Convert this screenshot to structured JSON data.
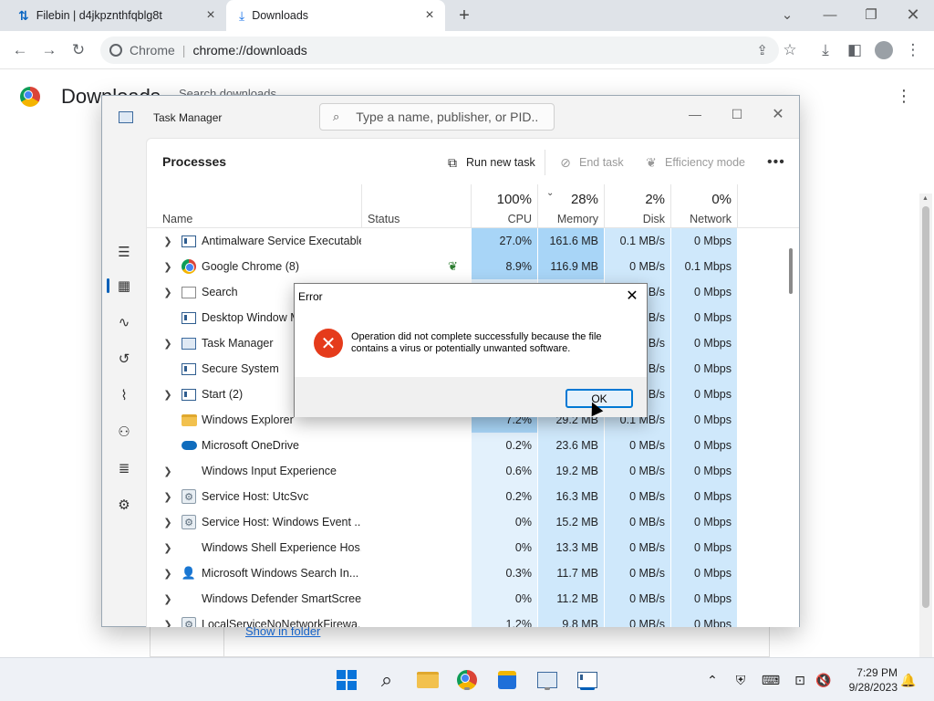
{
  "browser": {
    "tabs": [
      {
        "label": "Filebin | d4jkpznthfqblg8t",
        "active": false
      },
      {
        "label": "Downloads",
        "active": true
      }
    ],
    "omnibox_scheme": "Chrome",
    "omnibox_url": "chrome://downloads"
  },
  "downloads_page": {
    "title": "Downloads",
    "search_placeholder": "Search downloads",
    "show_in_folder": "Show in folder"
  },
  "task_manager": {
    "window_title": "Task Manager",
    "search_placeholder": "Type a name, publisher, or PID...",
    "page_title": "Processes",
    "commands": {
      "run_new_task": "Run new task",
      "end_task": "End task",
      "efficiency_mode": "Efficiency mode"
    },
    "columns": {
      "name": "Name",
      "status": "Status",
      "cpu_pct": "100%",
      "cpu": "CPU",
      "memory_pct": "28%",
      "memory": "Memory",
      "disk_pct": "2%",
      "disk": "Disk",
      "network_pct": "0%",
      "network": "Network"
    },
    "processes": [
      {
        "name": "Antimalware Service Executable",
        "expandable": true,
        "icon": "window-icon",
        "cpu": "27.0%",
        "memory": "161.6 MB",
        "disk": "0.1 MB/s",
        "network": "0 Mbps",
        "leaf": false
      },
      {
        "name": "Google Chrome (8)",
        "expandable": true,
        "icon": "chrome-icon",
        "cpu": "8.9%",
        "memory": "116.9 MB",
        "disk": "0 MB/s",
        "network": "0.1 Mbps",
        "leaf": true
      },
      {
        "name": "Search",
        "expandable": true,
        "icon": "envelope-icon",
        "cpu": "",
        "memory": "",
        "disk": "MB/s",
        "network": "0 Mbps",
        "leaf": false
      },
      {
        "name": "Desktop Window M",
        "expandable": false,
        "icon": "window-icon",
        "cpu": "",
        "memory": "",
        "disk": "MB/s",
        "network": "0 Mbps",
        "leaf": false
      },
      {
        "name": "Task Manager",
        "expandable": true,
        "icon": "task-manager-icon",
        "cpu": "",
        "memory": "",
        "disk": "MB/s",
        "network": "0 Mbps",
        "leaf": false
      },
      {
        "name": "Secure System",
        "expandable": false,
        "icon": "window-icon",
        "cpu": "",
        "memory": "",
        "disk": "MB/s",
        "network": "0 Mbps",
        "leaf": false
      },
      {
        "name": "Start (2)",
        "expandable": true,
        "icon": "window-icon",
        "cpu": "",
        "memory": "",
        "disk": "MB/s",
        "network": "0 Mbps",
        "leaf": false
      },
      {
        "name": "Windows Explorer",
        "expandable": false,
        "icon": "folder-icon",
        "cpu": "7.2%",
        "memory": "29.2 MB",
        "disk": "0.1 MB/s",
        "network": "0 Mbps",
        "leaf": false
      },
      {
        "name": "Microsoft OneDrive",
        "expandable": false,
        "icon": "cloud-icon",
        "cpu": "0.2%",
        "memory": "23.6 MB",
        "disk": "0 MB/s",
        "network": "0 Mbps",
        "leaf": false
      },
      {
        "name": "Windows Input Experience",
        "expandable": true,
        "icon": "",
        "cpu": "0.6%",
        "memory": "19.2 MB",
        "disk": "0 MB/s",
        "network": "0 Mbps",
        "leaf": false
      },
      {
        "name": "Service Host: UtcSvc",
        "expandable": true,
        "icon": "gear-icon",
        "cpu": "0.2%",
        "memory": "16.3 MB",
        "disk": "0 MB/s",
        "network": "0 Mbps",
        "leaf": false
      },
      {
        "name": "Service Host: Windows Event ...",
        "expandable": true,
        "icon": "gear-icon",
        "cpu": "0%",
        "memory": "15.2 MB",
        "disk": "0 MB/s",
        "network": "0 Mbps",
        "leaf": false
      },
      {
        "name": "Windows Shell Experience Hos...",
        "expandable": true,
        "icon": "",
        "cpu": "0%",
        "memory": "13.3 MB",
        "disk": "0 MB/s",
        "network": "0 Mbps",
        "leaf": false
      },
      {
        "name": "Microsoft Windows Search In...",
        "expandable": true,
        "icon": "user-icon",
        "cpu": "0.3%",
        "memory": "11.7 MB",
        "disk": "0 MB/s",
        "network": "0 Mbps",
        "leaf": false
      },
      {
        "name": "Windows Defender SmartScreen",
        "expandable": true,
        "icon": "",
        "cpu": "0%",
        "memory": "11.2 MB",
        "disk": "0 MB/s",
        "network": "0 Mbps",
        "leaf": false
      },
      {
        "name": "LocalServiceNoNetworkFirewa...",
        "expandable": true,
        "icon": "gear-icon",
        "cpu": "1.2%",
        "memory": "9.8 MB",
        "disk": "0 MB/s",
        "network": "0 Mbps",
        "leaf": false
      }
    ]
  },
  "error_dialog": {
    "title": "Error",
    "message": "Operation did not complete successfully because the file contains a virus or potentially unwanted software.",
    "ok_label": "OK"
  },
  "taskbar": {
    "time": "7:29 PM",
    "date": "9/28/2023"
  },
  "colors": {
    "accent": "#005fb8",
    "error": "#e53b1b",
    "link": "#1a73e8",
    "cpu_highlight": "#a8d5f7"
  }
}
